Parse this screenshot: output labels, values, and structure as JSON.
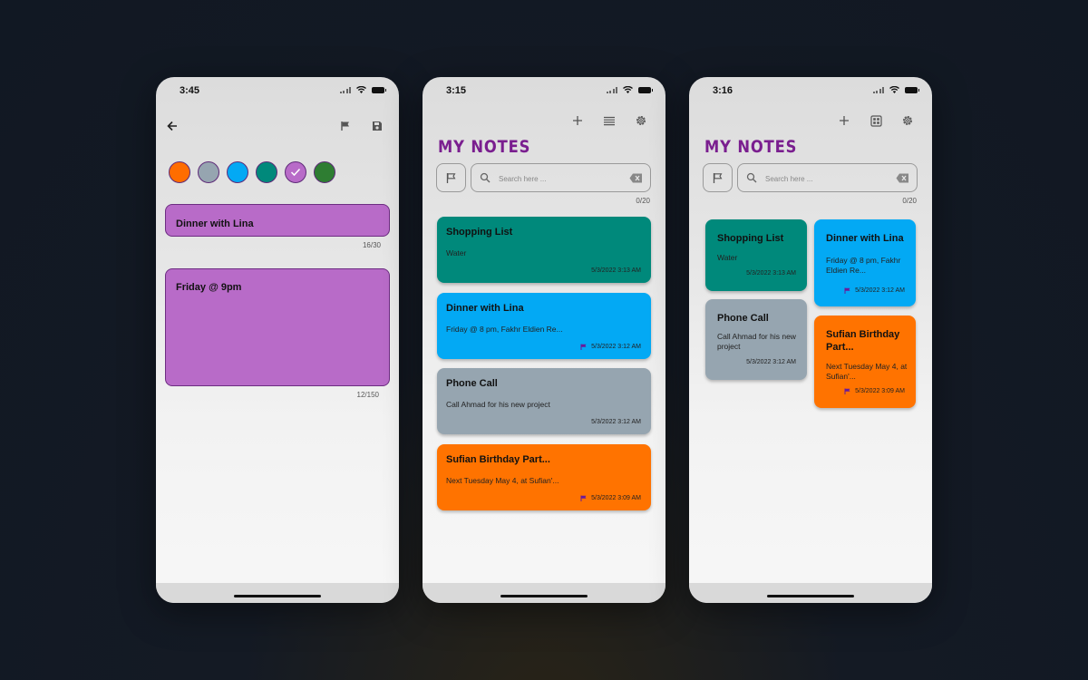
{
  "colors": {
    "accent_purple": "#7a1e8f",
    "teal": "#00897b",
    "blue": "#03a9f4",
    "gray": "#96a5b0",
    "orange": "#ff7300",
    "editor_note": "#b86bc8",
    "flag_purple": "#6a1b9a"
  },
  "editor": {
    "time": "3:45",
    "icons": [
      "back-arrow-icon",
      "flag-icon",
      "save-icon"
    ],
    "swatches": [
      {
        "name": "orange",
        "color": "#ff6d00",
        "selected": false
      },
      {
        "name": "gray",
        "color": "#96a5b0",
        "selected": false
      },
      {
        "name": "blue",
        "color": "#03a9f4",
        "selected": false
      },
      {
        "name": "teal",
        "color": "#00897b",
        "selected": false
      },
      {
        "name": "purple",
        "color": "#b86bc8",
        "selected": true
      },
      {
        "name": "green",
        "color": "#2e7d32",
        "selected": false
      }
    ],
    "title_value": "Dinner with Lina",
    "title_counter": "16/30",
    "body_value": "Friday @ 9pm",
    "body_counter": "12/150"
  },
  "list_screen": {
    "time": "3:15",
    "app_title": "MY NOTES",
    "search_placeholder": "Search here ...",
    "search_count": "0/20",
    "icons": [
      "plus-icon",
      "list-view-icon",
      "gear-icon",
      "flag-icon",
      "search-icon",
      "backspace-icon"
    ],
    "notes": [
      {
        "title": "Shopping List",
        "body": "Water",
        "date": "5/3/2022 3:13 AM",
        "color": "#00897b",
        "flagged": false
      },
      {
        "title": "Dinner with Lina",
        "body": "Friday @ 8 pm, Fakhr Eldien Re...",
        "date": "5/3/2022 3:12 AM",
        "color": "#03a9f4",
        "flagged": true
      },
      {
        "title": "Phone Call",
        "body": "Call Ahmad for his new project",
        "date": "5/3/2022 3:12 AM",
        "color": "#96a5b0",
        "flagged": false
      },
      {
        "title": "Sufian Birthday Part...",
        "body": "Next Tuesday May 4, at Sufian'...",
        "date": "5/3/2022 3:09 AM",
        "color": "#ff7300",
        "flagged": true
      }
    ]
  },
  "grid_screen": {
    "time": "3:16",
    "app_title": "MY NOTES",
    "search_placeholder": "Search here ...",
    "search_count": "0/20",
    "icons": [
      "plus-icon",
      "grid-view-icon",
      "gear-icon",
      "flag-icon",
      "search-icon",
      "backspace-icon"
    ],
    "left_column": [
      {
        "title": "Shopping List",
        "body": "Water",
        "date": "5/3/2022 3:13 AM",
        "color": "#00897b",
        "flagged": false
      },
      {
        "title": "Phone Call",
        "body": "Call Ahmad for his new project",
        "date": "5/3/2022 3:12 AM",
        "color": "#96a5b0",
        "flagged": false
      }
    ],
    "right_column": [
      {
        "title": "Dinner with Lina",
        "body": "Friday @ 8 pm, Fakhr Eldien Re...",
        "date": "5/3/2022 3:12 AM",
        "color": "#03a9f4",
        "flagged": true
      },
      {
        "title": "Sufian Birthday Part...",
        "body": "Next Tuesday May 4, at Sufian'...",
        "date": "5/3/2022 3:09 AM",
        "color": "#ff7300",
        "flagged": true
      }
    ]
  }
}
